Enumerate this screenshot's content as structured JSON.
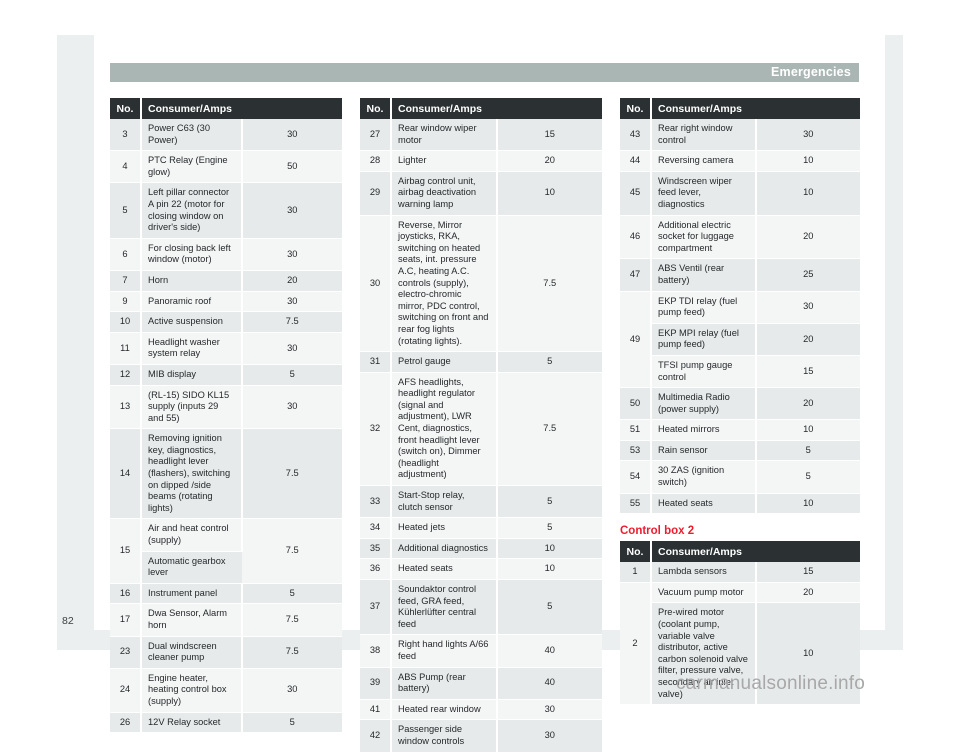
{
  "page": {
    "header_title": "Emergencies",
    "page_number": "82",
    "watermark": "carmanualsonline.info"
  },
  "columns": [
    {
      "id": "column-left",
      "tables": [
        {
          "id": "table-left",
          "headers": {
            "no": "No.",
            "consumer": "Consumer/Amps"
          },
          "rows": [
            {
              "no": "3",
              "desc": "Power C63 (30 Power)",
              "amps": "30"
            },
            {
              "no": "4",
              "desc": "PTC Relay (Engine glow)",
              "amps": "50"
            },
            {
              "no": "5",
              "desc": "Left pillar connector A pin 22 (motor for closing window on driver's side)",
              "amps": "30"
            },
            {
              "no": "6",
              "desc": "For closing back left window (motor)",
              "amps": "30"
            },
            {
              "no": "7",
              "desc": "Horn",
              "amps": "20"
            },
            {
              "no": "9",
              "desc": "Panoramic roof",
              "amps": "30"
            },
            {
              "no": "10",
              "desc": "Active suspension",
              "amps": "7.5"
            },
            {
              "no": "11",
              "desc": "Headlight washer system relay",
              "amps": "30"
            },
            {
              "no": "12",
              "desc": "MIB display",
              "amps": "5"
            },
            {
              "no": "13",
              "desc": "(RL-15) SIDO KL15 supply (inputs 29 and 55)",
              "amps": "30"
            },
            {
              "no": "14",
              "desc": "Removing ignition key, diagnostics, headlight lever (flashers), switching on dipped /side beams (rotating lights)",
              "amps": "7.5"
            },
            {
              "no": "15",
              "sub": [
                "Air and heat control (supply)",
                "Automatic gearbox lever"
              ],
              "amps": "7.5"
            },
            {
              "no": "16",
              "desc": "Instrument panel",
              "amps": "5"
            },
            {
              "no": "17",
              "desc": "Dwa Sensor, Alarm horn",
              "amps": "7.5"
            },
            {
              "no": "23",
              "desc": "Dual windscreen cleaner pump",
              "amps": "7.5"
            },
            {
              "no": "24",
              "desc": "Engine heater, heating control box (supply)",
              "amps": "30"
            },
            {
              "no": "26",
              "desc": "12V Relay socket",
              "amps": "5"
            }
          ]
        }
      ]
    },
    {
      "id": "column-middle",
      "tables": [
        {
          "id": "table-middle",
          "headers": {
            "no": "No.",
            "consumer": "Consumer/Amps"
          },
          "rows": [
            {
              "no": "27",
              "desc": "Rear window wiper motor",
              "amps": "15"
            },
            {
              "no": "28",
              "desc": "Lighter",
              "amps": "20"
            },
            {
              "no": "29",
              "desc": "Airbag control unit, airbag deactivation warning lamp",
              "amps": "10"
            },
            {
              "no": "30",
              "desc": "Reverse, Mirror joysticks, RKA, switching on heated seats, int. pressure A.C, heating A.C. controls (supply), electro-chromic mirror, PDC control, switching on front and rear fog lights (rotating lights).",
              "amps": "7.5"
            },
            {
              "no": "31",
              "desc": "Petrol gauge",
              "amps": "5"
            },
            {
              "no": "32",
              "desc": "AFS headlights, headlight regulator (signal and adjustment), LWR Cent, diagnostics, front headlight lever (switch on), Dimmer (headlight adjustment)",
              "amps": "7.5"
            },
            {
              "no": "33",
              "desc": "Start-Stop relay, clutch sensor",
              "amps": "5"
            },
            {
              "no": "34",
              "desc": "Heated jets",
              "amps": "5"
            },
            {
              "no": "35",
              "desc": "Additional diagnostics",
              "amps": "10"
            },
            {
              "no": "36",
              "desc": "Heated seats",
              "amps": "10"
            },
            {
              "no": "37",
              "desc": "Soundaktor control feed, GRA feed, Kühlerlüfter central feed",
              "amps": "5"
            },
            {
              "no": "38",
              "desc": "Right hand lights A/66 feed",
              "amps": "40"
            },
            {
              "no": "39",
              "desc": "ABS Pump (rear battery)",
              "amps": "40"
            },
            {
              "no": "41",
              "desc": "Heated rear window",
              "amps": "30"
            },
            {
              "no": "42",
              "desc": "Passenger side window controls",
              "amps": "30"
            }
          ]
        }
      ]
    },
    {
      "id": "column-right",
      "tables": [
        {
          "id": "table-right-1",
          "headers": {
            "no": "No.",
            "consumer": "Consumer/Amps"
          },
          "rows": [
            {
              "no": "43",
              "desc": "Rear right window control",
              "amps": "30"
            },
            {
              "no": "44",
              "desc": "Reversing camera",
              "amps": "10"
            },
            {
              "no": "45",
              "desc": "Windscreen wiper feed lever, diagnostics",
              "amps": "10"
            },
            {
              "no": "46",
              "desc": "Additional electric socket for luggage compartment",
              "amps": "20"
            },
            {
              "no": "47",
              "desc": "ABS Ventil (rear battery)",
              "amps": "25"
            },
            {
              "no": "49",
              "multi": [
                {
                  "desc": "EKP TDI relay (fuel pump feed)",
                  "amps": "30"
                },
                {
                  "desc": "EKP MPI relay (fuel pump feed)",
                  "amps": "20"
                },
                {
                  "desc": "TFSI pump gauge control",
                  "amps": "15"
                }
              ]
            },
            {
              "no": "50",
              "desc": "Multimedia Radio (power supply)",
              "amps": "20"
            },
            {
              "no": "51",
              "desc": "Heated mirrors",
              "amps": "10"
            },
            {
              "no": "53",
              "desc": "Rain sensor",
              "amps": "5"
            },
            {
              "no": "54",
              "desc": "30 ZAS (ignition switch)",
              "amps": "5"
            },
            {
              "no": "55",
              "desc": "Heated seats",
              "amps": "10"
            }
          ]
        },
        {
          "id": "table-right-2",
          "section_title": "Control box 2",
          "headers": {
            "no": "No.",
            "consumer": "Consumer/Amps"
          },
          "rows": [
            {
              "no": "1",
              "desc": "Lambda sensors",
              "amps": "15"
            },
            {
              "no": "2",
              "multi": [
                {
                  "desc": "Vacuum pump motor",
                  "amps": "20"
                },
                {
                  "desc": "Pre-wired motor (coolant pump, variable valve distributor, active carbon solenoid valve filter, pressure valve, secondary air inlet valve)",
                  "amps": "10"
                }
              ]
            }
          ]
        }
      ]
    }
  ],
  "colors": {
    "header_bar": "#a9b6b4",
    "table_header": "#2b3133",
    "accent_red": "#ed1c2e",
    "stripe_dark": "#e7eaeb",
    "stripe_light": "#f4f6f6"
  }
}
